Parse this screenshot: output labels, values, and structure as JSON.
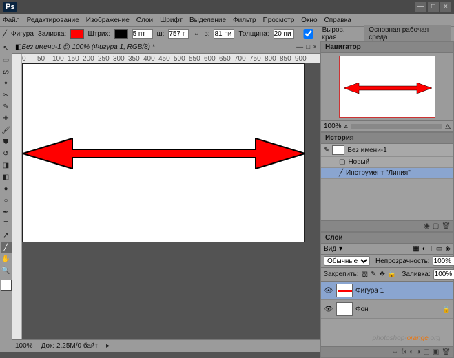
{
  "app": {
    "logo": "Ps"
  },
  "menu": {
    "file": "Файл",
    "edit": "Редактирование",
    "image": "Изображение",
    "layer": "Слои",
    "type": "Шрифт",
    "select": "Выделение",
    "filter": "Фильтр",
    "view": "Просмотр",
    "window": "Окно",
    "help": "Справка"
  },
  "options": {
    "shape": "Фигура",
    "fill": "Заливка:",
    "fill_color": "#ff0000",
    "stroke": "Штрих:",
    "stroke_color": "#000000",
    "stroke_size": "5 пт",
    "w_label": "ш:",
    "w_val": "757 г",
    "h_label": "в:",
    "h_val": "81 пи",
    "weight_label": "Толщина:",
    "weight_val": "20 пи",
    "edges": "Выров. края",
    "workspace": "Основная рабочая среда"
  },
  "document": {
    "tab": "Без имени-1 @ 100% (Фигура 1, RGB/8) *",
    "zoom": "100%",
    "docinfo": "Док: 2,25M/0 байт"
  },
  "ruler": {
    "t0": "0",
    "t1": "50",
    "t2": "100",
    "t3": "150",
    "t4": "200",
    "t5": "250",
    "t6": "300",
    "t7": "350",
    "t8": "400",
    "t9": "450",
    "t10": "500",
    "t11": "550",
    "t12": "600",
    "t13": "650",
    "t14": "700",
    "t15": "750",
    "t16": "800",
    "t17": "850",
    "t18": "900"
  },
  "navigator": {
    "title": "Навигатор",
    "zoom": "100%"
  },
  "history": {
    "title": "История",
    "doc": "Без имени-1",
    "step1": "Новый",
    "step2": "Инструмент \"Линия\""
  },
  "layers": {
    "title": "Слои",
    "kind": "Вид",
    "mode": "Обычные",
    "opacity_label": "Непрозрачность:",
    "opacity": "100%",
    "lock_label": "Закрепить:",
    "fill_label": "Заливка:",
    "fill": "100%",
    "layer1": "Фигура 1",
    "layer2": "Фон"
  },
  "watermark": {
    "brand": "photoshop-",
    "orange": "orange",
    "suffix": ".org"
  }
}
